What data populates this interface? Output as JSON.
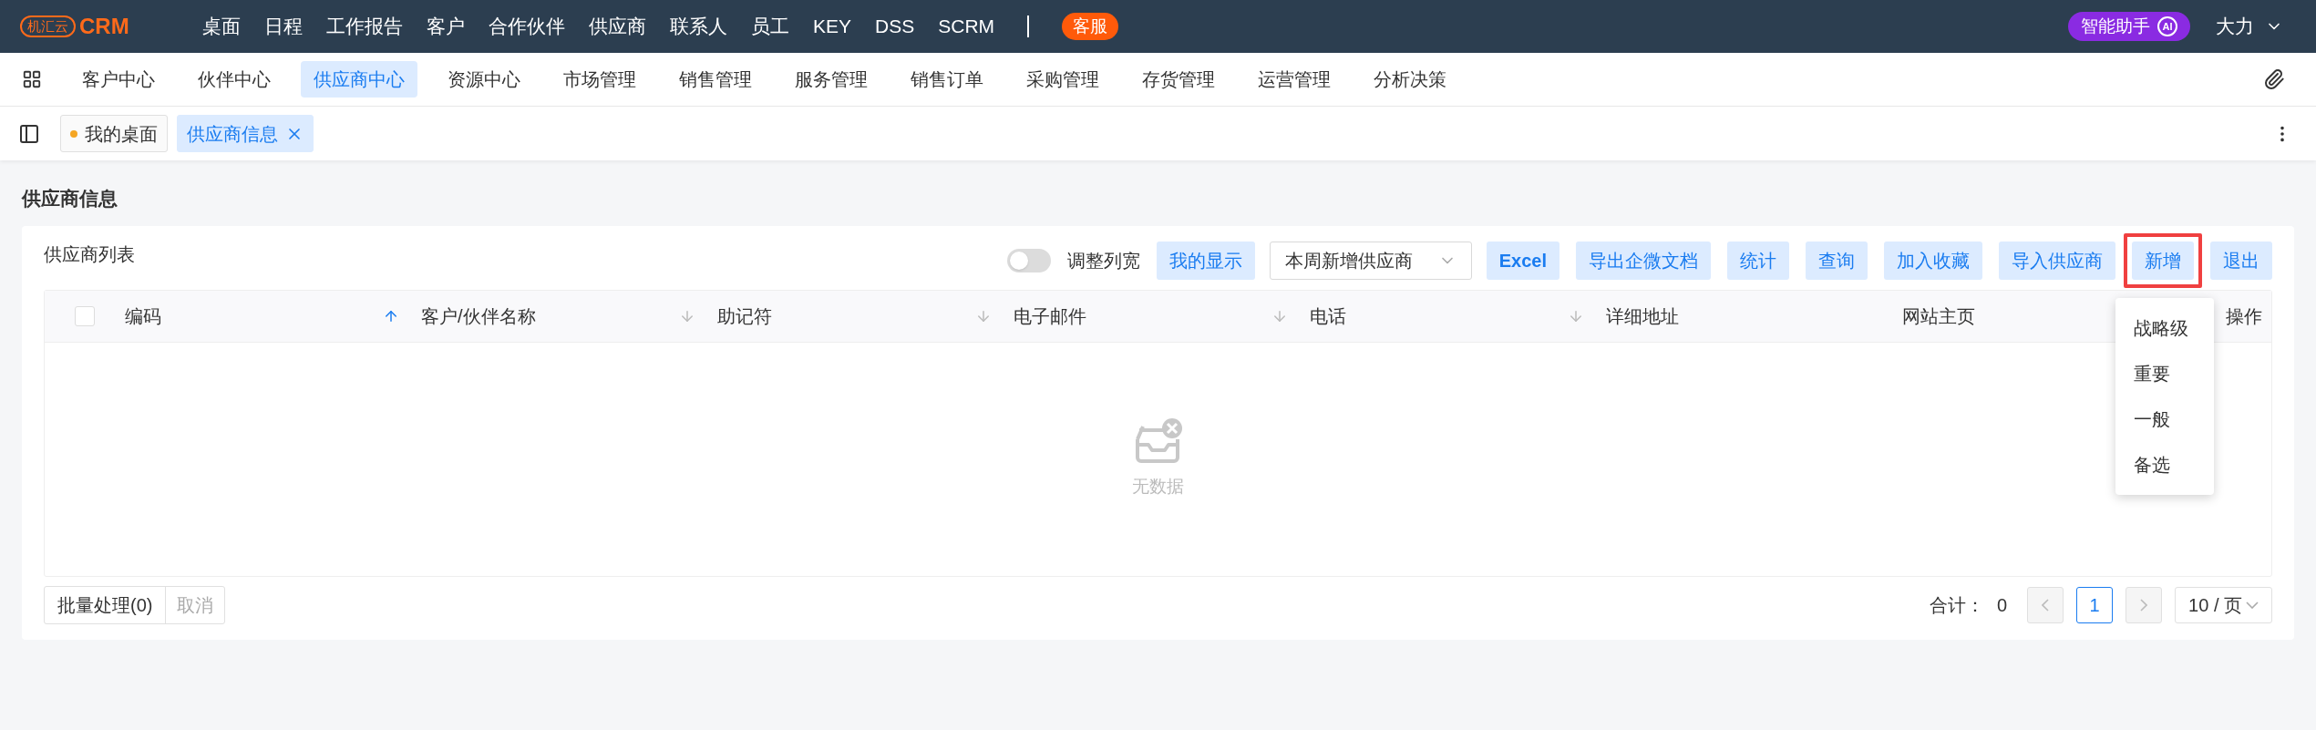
{
  "header": {
    "logo": {
      "mark": "机汇云",
      "name": "CRM"
    },
    "menu": [
      "桌面",
      "日程",
      "工作报告",
      "客户",
      "合作伙伴",
      "供应商",
      "联系人",
      "员工",
      "KEY",
      "DSS",
      "SCRM"
    ],
    "service_badge": "客服",
    "assistant": {
      "label": "智能助手",
      "badge": "AI"
    },
    "user": "大力"
  },
  "modules": [
    {
      "label": "客户中心",
      "selected": false
    },
    {
      "label": "伙伴中心",
      "selected": false
    },
    {
      "label": "供应商中心",
      "selected": true
    },
    {
      "label": "资源中心",
      "selected": false
    },
    {
      "label": "市场管理",
      "selected": false
    },
    {
      "label": "销售管理",
      "selected": false
    },
    {
      "label": "服务管理",
      "selected": false
    },
    {
      "label": "销售订单",
      "selected": false
    },
    {
      "label": "采购管理",
      "selected": false
    },
    {
      "label": "存货管理",
      "selected": false
    },
    {
      "label": "运营管理",
      "selected": false
    },
    {
      "label": "分析决策",
      "selected": false
    }
  ],
  "page_tabs": [
    {
      "label": "我的桌面",
      "selected": false,
      "closable": false
    },
    {
      "label": "供应商信息",
      "selected": true,
      "closable": true
    }
  ],
  "page_title": "供应商信息",
  "list": {
    "title": "供应商列表",
    "toggle": {
      "label": "调整列宽",
      "on": false
    },
    "view_button": "我的显示",
    "filter_select": {
      "value": "本周新增供应商"
    },
    "buttons": [
      {
        "label": "Excel",
        "highlighted": false
      },
      {
        "label": "导出企微文档",
        "highlighted": false
      },
      {
        "label": "统计",
        "highlighted": false
      },
      {
        "label": "查询",
        "highlighted": false
      },
      {
        "label": "加入收藏",
        "highlighted": false
      },
      {
        "label": "导入供应商",
        "highlighted": false
      },
      {
        "label": "新增",
        "highlighted": true
      },
      {
        "label": "退出",
        "highlighted": false
      }
    ],
    "add_menu": [
      "战略级",
      "重要",
      "一般",
      "备选"
    ],
    "select_all": {
      "checked": false
    },
    "columns": [
      {
        "label": "编码",
        "sortable": true,
        "sort_active": true
      },
      {
        "label": "客户/伙伴名称",
        "sortable": true,
        "sort_active": false
      },
      {
        "label": "助记符",
        "sortable": true,
        "sort_active": false
      },
      {
        "label": "电子邮件",
        "sortable": true,
        "sort_active": false
      },
      {
        "label": "电话",
        "sortable": true,
        "sort_active": false
      },
      {
        "label": "详细地址",
        "sortable": false
      },
      {
        "label": "网站主页",
        "sortable": false
      },
      {
        "label": "操作",
        "sortable": false
      }
    ],
    "empty_text": "无数据",
    "batch_button": "批量处理(0)",
    "cancel_button": "取消",
    "total_label": "合计：",
    "total": "0",
    "pages": [
      {
        "label": "1",
        "selected": true
      }
    ],
    "page_size": "10 / 页"
  }
}
